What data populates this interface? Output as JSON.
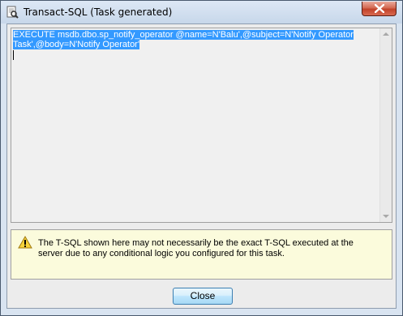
{
  "window": {
    "title": "Transact-SQL (Task generated)",
    "icon": "sql-document-icon",
    "close_icon": "close-icon"
  },
  "editor": {
    "line1": "EXECUTE msdb.dbo.sp_notify_operator @name=N'Balu',@subject=N'Notify Operator",
    "line2": "Task',@body=N'Notify Operator'",
    "selection_color": "#3399ff"
  },
  "warning": {
    "icon": "warning-icon",
    "text": "The T-SQL shown here may not necessarily be the exact T-SQL executed at the server due to any conditional logic you configured for this task.",
    "background": "#fbfbdc"
  },
  "footer": {
    "close_label": "Close"
  }
}
